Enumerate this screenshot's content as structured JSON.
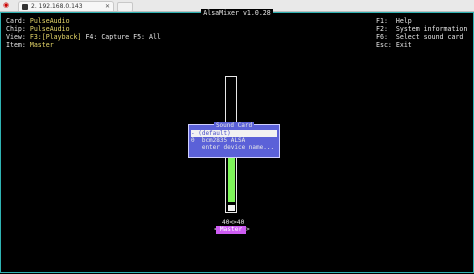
{
  "tab": {
    "title": "2. 192.168.0.143",
    "close": "✕"
  },
  "window": {
    "title": "AlsaMixer v1.0.28"
  },
  "info": {
    "card_label": "Card:",
    "card_value": "PulseAudio",
    "chip_label": "Chip:",
    "chip_value": "PulseAudio",
    "view_label": "View:",
    "view_f3": "F3:[Playback]",
    "view_f4": "F4: Capture",
    "view_f5": "F5: All",
    "item_label": "Item:",
    "item_value": "Master"
  },
  "help": {
    "items": [
      {
        "key": "F1:",
        "label": "Help"
      },
      {
        "key": "F2:",
        "label": "System information"
      },
      {
        "key": "F6:",
        "label": "Select sound card"
      },
      {
        "key": "Esc:",
        "label": "Exit"
      }
    ]
  },
  "control": {
    "volume": "40<>40",
    "name": "Master",
    "level_fraction": 0.35
  },
  "dialog": {
    "title": "Sound Card",
    "items": [
      "- (default)",
      "0  bcm2835 ALSA",
      "   enter device name..."
    ],
    "selected_index": 0
  },
  "colors": {
    "accent": "#2fb3b3",
    "yellow": "#e8d96a",
    "dialog_bg": "#5b61d8",
    "level_green": "#7ef55a",
    "channel_bg": "#ce5cf3"
  }
}
